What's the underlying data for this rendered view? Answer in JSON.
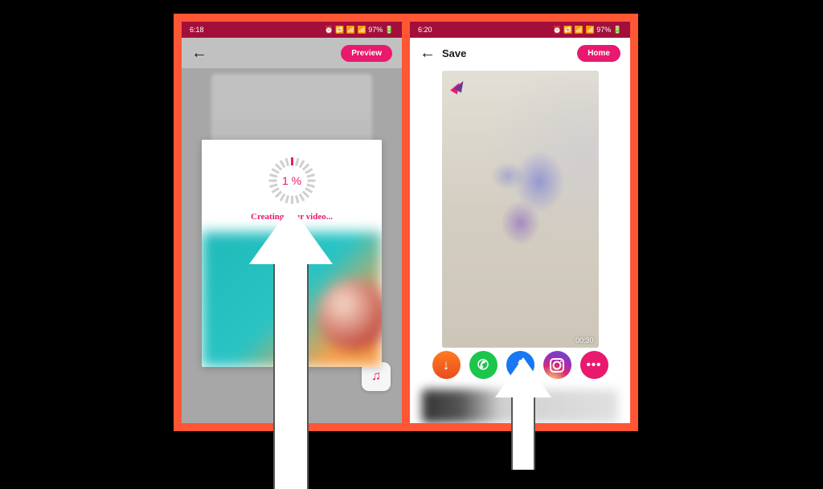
{
  "phone1": {
    "status_time": "6:18",
    "status_right": "⏰ 🔁 📶 📶 97% 🔋",
    "preview_btn": "Preview",
    "progress_label": "1 %",
    "creating_label": "Creating your video..."
  },
  "phone2": {
    "status_time": "6:20",
    "status_right": "⏰ 🔁 📶 📶 97% 🔋",
    "title": "Save",
    "home_btn": "Home",
    "video_duration": "00:30",
    "share": {
      "download": "↓",
      "whatsapp": "✆",
      "facebook": "f",
      "instagram": "",
      "more": "•••"
    }
  }
}
